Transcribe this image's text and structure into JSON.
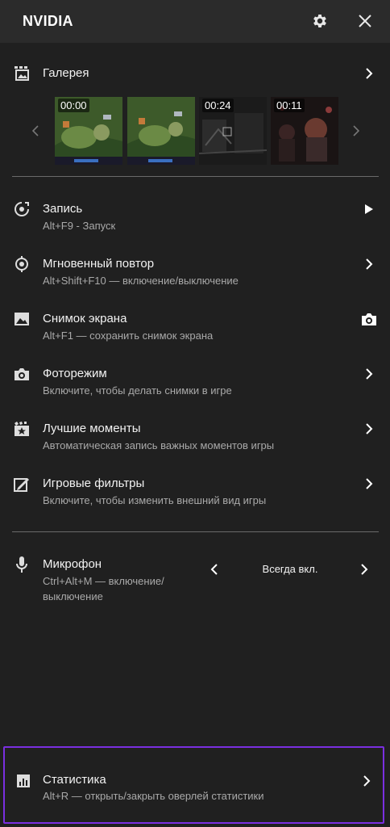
{
  "header": {
    "title": "NVIDIA",
    "settings_icon": "gear-icon",
    "close_icon": "close-icon"
  },
  "gallery": {
    "title": "Галерея",
    "icon": "gallery-icon",
    "thumbnails": [
      {
        "time": "00:00",
        "kind": "game-moba"
      },
      {
        "time": "",
        "kind": "game-moba"
      },
      {
        "time": "00:24",
        "kind": "dark-scene"
      },
      {
        "time": "00:11",
        "kind": "crowd-scene"
      }
    ]
  },
  "items": [
    {
      "title": "Запись",
      "subtitle": "Alt+F9 - Запуск",
      "icon": "record-icon",
      "action": "play-icon"
    },
    {
      "title": "Мгновенный повтор",
      "subtitle": "Alt+Shift+F10 — включение/выключение",
      "icon": "instant-replay-icon",
      "action": "chevron-right-icon"
    },
    {
      "title": "Снимок экрана",
      "subtitle": "Alt+F1 — сохранить снимок экрана",
      "icon": "image-icon",
      "action": "camera-icon"
    },
    {
      "title": "Фоторежим",
      "subtitle": "Включите, чтобы делать снимки в игре",
      "icon": "camera-icon",
      "action": "chevron-right-icon"
    },
    {
      "title": "Лучшие моменты",
      "subtitle": "Автоматическая запись важных моментов игры",
      "icon": "highlights-icon",
      "action": "chevron-right-icon"
    },
    {
      "title": "Игровые фильтры",
      "subtitle": "Включите, чтобы изменить внешний вид игры",
      "icon": "filter-icon",
      "action": "chevron-right-icon"
    }
  ],
  "microphone": {
    "title": "Микрофон",
    "subtitle_line1": "Ctrl+Alt+M — включение/",
    "subtitle_line2": "выключение",
    "value": "Всегда вкл.",
    "icon": "microphone-icon"
  },
  "stats": {
    "title": "Статистика",
    "subtitle": "Alt+R — открыть/закрыть оверлей статистики",
    "icon": "stats-icon"
  },
  "colors": {
    "background": "#202020",
    "header": "#2b2b2b",
    "highlight_border": "#7a2fe0",
    "subtitle": "#a9a9a9"
  }
}
